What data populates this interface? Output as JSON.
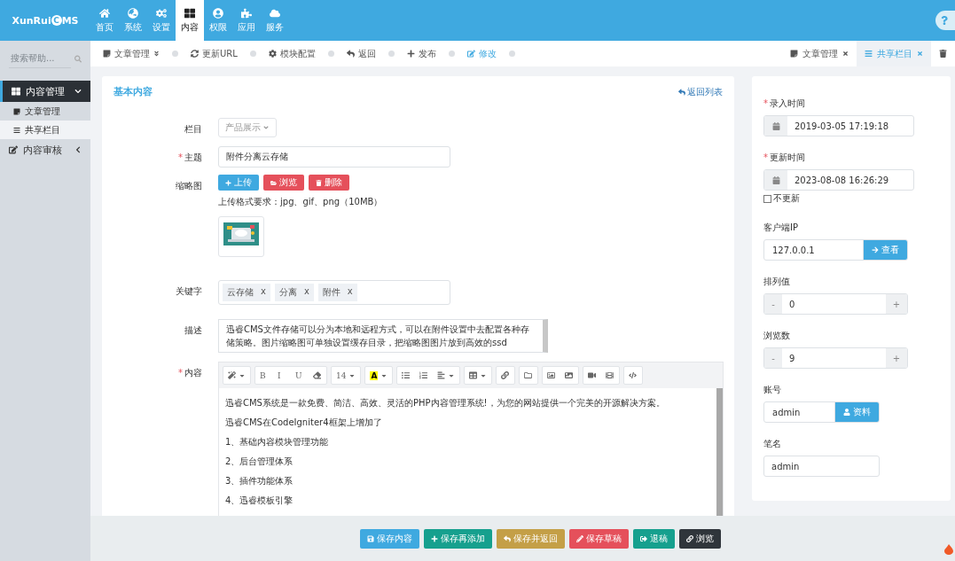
{
  "logo": {
    "before": "XunRui",
    "mark": "C",
    "after": "MS"
  },
  "required_mark": "*",
  "top_nav": [
    {
      "label": "首页",
      "selected": false
    },
    {
      "label": "系统",
      "selected": false
    },
    {
      "label": "设置",
      "selected": false
    },
    {
      "label": "内容",
      "selected": true
    },
    {
      "label": "权限",
      "selected": false
    },
    {
      "label": "应用",
      "selected": false
    },
    {
      "label": "服务",
      "selected": false
    }
  ],
  "sidebar": {
    "search": {
      "placeholder": "搜索帮助..."
    },
    "items": [
      {
        "label": "内容管理",
        "selected": true,
        "expanded": true,
        "children": [
          {
            "label": "文章管理",
            "selected": false
          },
          {
            "label": "共享栏目",
            "selected": true
          }
        ]
      },
      {
        "label": "内容审核",
        "selected": false,
        "expanded": false
      }
    ]
  },
  "toolbar": [
    {
      "label": "文章管理",
      "dropdown": true,
      "selected": false
    },
    {
      "label": "更新URL",
      "dropdown": false,
      "selected": false
    },
    {
      "label": "模块配置",
      "dropdown": false,
      "selected": false
    },
    {
      "label": "返回",
      "dropdown": false,
      "selected": false
    },
    {
      "label": "发布",
      "dropdown": false,
      "selected": false
    },
    {
      "label": "修改",
      "dropdown": false,
      "selected": true
    }
  ],
  "open_tabs": [
    {
      "label": "文章管理",
      "selected": false
    },
    {
      "label": "共享栏目",
      "selected": true
    }
  ],
  "main": {
    "title": "基本内容",
    "back_link": "返回列表",
    "fields": [
      {
        "kind": "select",
        "label": "栏目",
        "required": false,
        "value": "产品展示"
      },
      {
        "kind": "text",
        "label": "主题",
        "required": true,
        "value": "附件分离云存储"
      },
      {
        "kind": "thumbnail",
        "label": "缩略图",
        "required": false,
        "buttons": [
          {
            "label": "上传",
            "color": "#3fa9e0"
          },
          {
            "label": "浏览",
            "color": "#e5505b"
          },
          {
            "label": "删除",
            "color": "#e5505b"
          }
        ],
        "hint": "上传格式要求：jpg、gif、png（10MB）"
      },
      {
        "kind": "tags",
        "label": "关键字",
        "required": false,
        "tags": [
          {
            "label": "云存储",
            "remove": "x"
          },
          {
            "label": "分离",
            "remove": "x"
          },
          {
            "label": "附件",
            "remove": "x"
          }
        ]
      },
      {
        "kind": "textarea",
        "label": "描述",
        "required": false,
        "value": "迅睿CMS文件存储可以分为本地和远程方式，可以在附件设置中去配置各种存储策略。图片缩略图可单独设置缓存目录，把缩略图图片放到高效的ssd"
      },
      {
        "kind": "editor",
        "label": "内容",
        "required": true,
        "toolbar": [
          [
            {
              "kind": "icon",
              "dropdown": true
            }
          ],
          [
            {
              "kind": "text",
              "label": "B",
              "dropdown": false
            },
            {
              "kind": "text",
              "label": "I",
              "dropdown": false
            },
            {
              "kind": "text",
              "label": "U",
              "dropdown": false
            },
            {
              "kind": "icon",
              "dropdown": false
            }
          ],
          [
            {
              "kind": "text",
              "label": "14",
              "dropdown": true
            }
          ],
          [
            {
              "kind": "color",
              "label": "A",
              "dropdown": true
            }
          ],
          [
            {
              "kind": "icon",
              "dropdown": false
            },
            {
              "kind": "icon",
              "dropdown": false
            },
            {
              "kind": "icon",
              "dropdown": true
            }
          ],
          [
            {
              "kind": "icon",
              "dropdown": true
            }
          ],
          [
            {
              "kind": "icon",
              "dropdown": false
            }
          ],
          [
            {
              "kind": "icon",
              "dropdown": false
            }
          ],
          [
            {
              "kind": "icon",
              "dropdown": false
            },
            {
              "kind": "icon",
              "dropdown": false
            }
          ],
          [
            {
              "kind": "icon",
              "dropdown": false
            },
            {
              "kind": "icon",
              "dropdown": false
            }
          ],
          [
            {
              "kind": "icon",
              "dropdown": false
            }
          ]
        ],
        "lines": [
          "迅睿CMS系统是一款免费、简洁、高效、灵活的PHP内容管理系统!，为您的网站提供一个完美的开源解决方案。",
          "迅睿CMS在CodeIgniter4框架上增加了",
          "1、基础内容模块管理功能",
          "2、后台管理体系",
          "3、插件功能体系",
          "4、迅睿模板引擎"
        ]
      }
    ]
  },
  "side_panel": {
    "fields": [
      {
        "kind": "date",
        "label": "录入时间",
        "required": true,
        "value": "2019-03-05 17:19:18"
      },
      {
        "kind": "date",
        "label": "更新时间",
        "required": true,
        "value": "2023-08-08 16:26:29",
        "option": {
          "label": "不更新",
          "checked": false
        }
      },
      {
        "kind": "input_button",
        "label": "客户端IP",
        "required": false,
        "value": "127.0.0.1",
        "button": "查看"
      },
      {
        "kind": "stepper",
        "label": "排列值",
        "required": false,
        "value": "0",
        "minus": "-",
        "plus": "+"
      },
      {
        "kind": "stepper",
        "label": "浏览数",
        "required": false,
        "value": "9",
        "minus": "-",
        "plus": "+"
      },
      {
        "kind": "input_button",
        "label": "账号",
        "required": false,
        "value": "admin",
        "button": "资料"
      },
      {
        "kind": "text",
        "label": "笔名",
        "required": false,
        "value": "admin"
      }
    ]
  },
  "actions": [
    {
      "label": "保存内容",
      "color": "#3fa9e0"
    },
    {
      "label": "保存再添加",
      "color": "#16a08e"
    },
    {
      "label": "保存并返回",
      "color": "#c49f47"
    },
    {
      "label": "保存草稿",
      "color": "#e5505b"
    },
    {
      "label": "退稿",
      "color": "#16a08e"
    },
    {
      "label": "浏览",
      "color": "#2f353b"
    }
  ]
}
